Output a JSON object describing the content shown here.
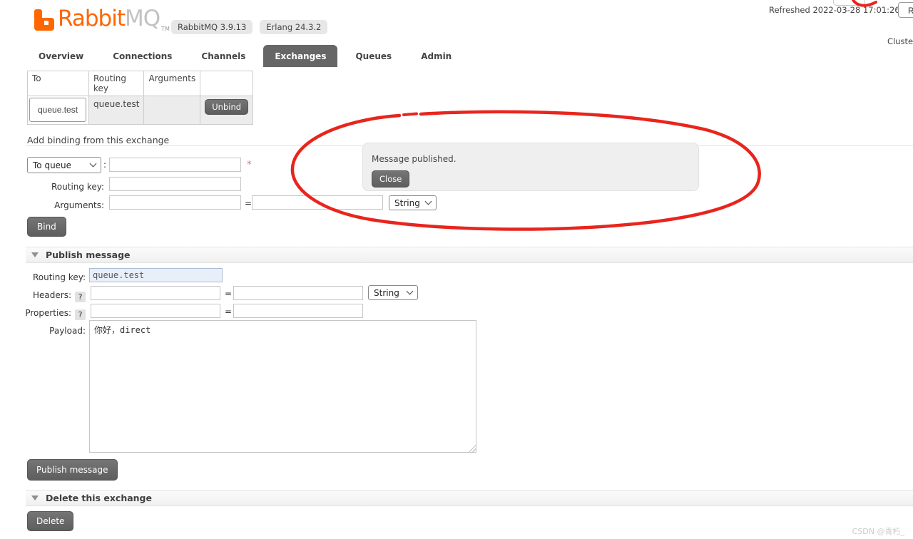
{
  "header": {
    "brand_rabbit": "Rabbit",
    "brand_mq": "MQ",
    "tm": "TM",
    "badges": [
      {
        "label": "RabbitMQ 3.9.13"
      },
      {
        "label": "Erlang 24.3.2"
      }
    ],
    "refreshed_label": "Refreshed 2022-03-28 17:01:26",
    "refresh_button_label": "Ref",
    "cluster_label": "Cluste"
  },
  "tabs": [
    {
      "label": "Overview"
    },
    {
      "label": "Connections"
    },
    {
      "label": "Channels"
    },
    {
      "label": "Exchanges"
    },
    {
      "label": "Queues"
    },
    {
      "label": "Admin"
    }
  ],
  "bindings_table": {
    "headers": [
      "To",
      "Routing key",
      "Arguments",
      ""
    ],
    "rows": [
      {
        "to": "queue.test",
        "routing_key": "queue.test",
        "arguments": "",
        "action": "Unbind"
      }
    ]
  },
  "add_binding": {
    "title": "Add binding from this exchange",
    "destination_select_value": "To queue",
    "colon": ":",
    "required_marker": "*",
    "routing_key_label": "Routing key:",
    "arguments_label": "Arguments:",
    "equals": "=",
    "type_select_value": "String",
    "bind_button": "Bind"
  },
  "notification": {
    "message": "Message published.",
    "close_button": "Close"
  },
  "publish": {
    "title": "Publish message",
    "routing_key_label": "Routing key:",
    "routing_key_value": "queue.test",
    "headers_label": "Headers:",
    "properties_label": "Properties:",
    "help_icon": "?",
    "equals": "=",
    "type_select_value": "String",
    "payload_label": "Payload:",
    "payload_value": "你好，direct",
    "publish_button": "Publish message"
  },
  "delete_section": {
    "title": "Delete this exchange",
    "delete_button": "Delete"
  },
  "watermark": "CSDN @青朽_",
  "colors": {
    "accent_orange": "#ff6600",
    "button_gray": "#666666",
    "annotation_red": "#e8251d",
    "highlight_blue": "#e9eff9"
  }
}
